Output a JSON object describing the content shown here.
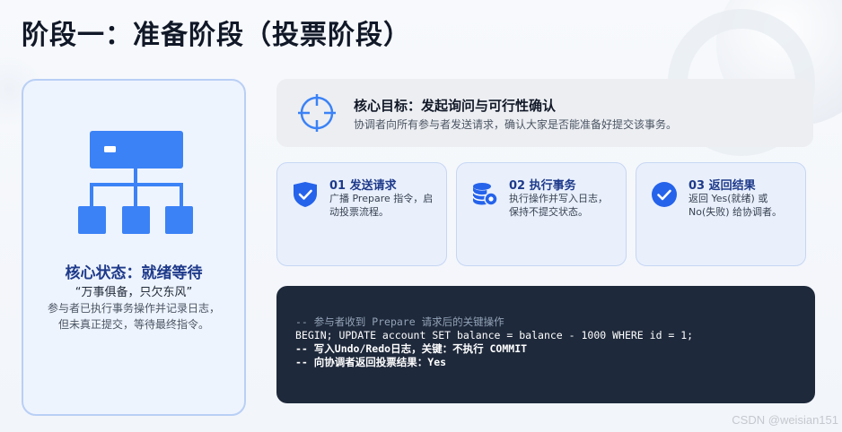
{
  "page": {
    "title": "阶段一：准备阶段（投票阶段）"
  },
  "state_card": {
    "icon": "hierarchy-icon",
    "title": "核心状态：就绪等待",
    "quote": "“万事俱备，只欠东风”",
    "description": "参与者已执行事务操作并记录日志，但未真正提交，等待最终指令。"
  },
  "goal": {
    "icon": "target-icon",
    "title": "核心目标：发起询问与可行性确认",
    "description": "协调者向所有参与者发送请求，确认大家是否能准备好提交该事务。"
  },
  "steps": [
    {
      "icon": "check-badge-icon",
      "title": "01 发送请求",
      "description": "广播 Prepare 指令，启动投票流程。"
    },
    {
      "icon": "database-gear-icon",
      "title": "02 执行事务",
      "description": "执行操作并写入日志，保持不提交状态。"
    },
    {
      "icon": "check-circle-icon",
      "title": "03 返回结果",
      "description": "返回 Yes(就绪) 或 No(失败) 给协调者。"
    }
  ],
  "code": {
    "lines": [
      "-- 参与者收到 Prepare 请求后的关键操作",
      "BEGIN; UPDATE account SET balance = balance - 1000 WHERE id = 1;",
      "-- 写入Undo/Redo日志，关键：不执行 COMMIT",
      "-- 向协调者返回投票结果：Yes"
    ]
  },
  "watermark": "CSDN @weisian151",
  "colors": {
    "accent": "#3b82f6",
    "dark_blue": "#1e3a8a",
    "code_bg": "#1e293b"
  }
}
